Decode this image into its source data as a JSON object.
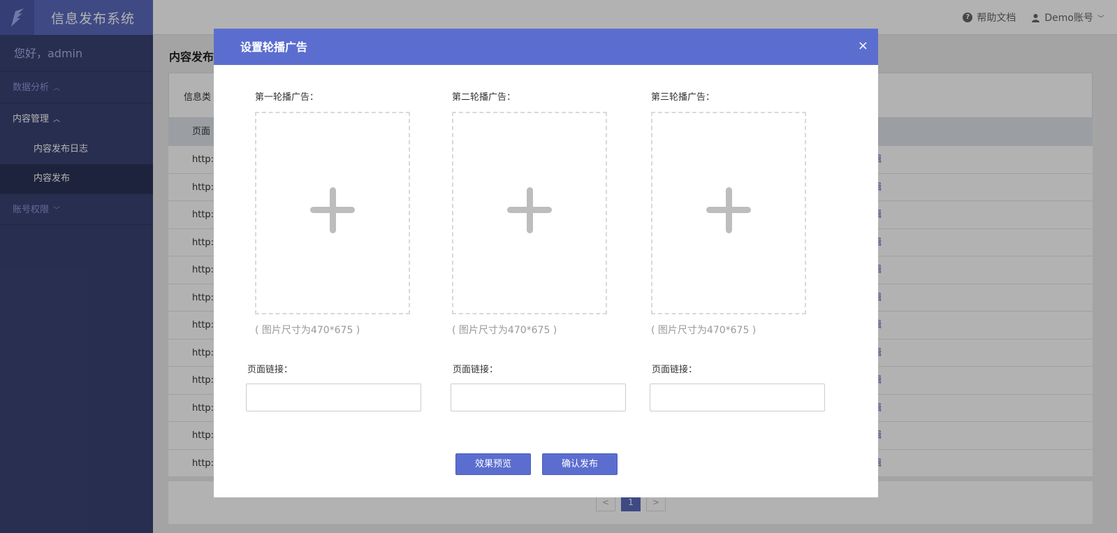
{
  "app": {
    "title": "信息发布系统",
    "greeting": "您好，admin"
  },
  "sidebar": {
    "groups": [
      {
        "label": "数据分析",
        "caret": "^"
      },
      {
        "label": "内容管理",
        "caret": "^"
      },
      {
        "label": "账号权限",
        "caret": "v"
      }
    ],
    "submenu": [
      "内容发布日志",
      "内容发布"
    ]
  },
  "topbar": {
    "help": "帮助文档",
    "account": "Demo账号"
  },
  "main": {
    "title": "内容发布",
    "filter_label": "信息类",
    "table_header": "页面",
    "row_url": "http:/",
    "row_action": "辑",
    "pager": {
      "prev": "<",
      "current": "1",
      "next": ">"
    }
  },
  "modal": {
    "title": "设置轮播广告",
    "close": "×",
    "slots": [
      {
        "label": "第一轮播广告：",
        "hint": "( 图片尺寸为470*675 )",
        "link_label": "页面链接：",
        "link_value": ""
      },
      {
        "label": "第二轮播广告：",
        "hint": "( 图片尺寸为470*675 )",
        "link_label": "页面链接：",
        "link_value": ""
      },
      {
        "label": "第三轮播广告：",
        "hint": "( 图片尺寸为470*675 )",
        "link_label": "页面链接：",
        "link_value": ""
      }
    ],
    "preview_button": "效果预览",
    "publish_button": "确认发布"
  },
  "colors": {
    "accent": "#5b6ed0",
    "sidebar": "#3a4372",
    "sidebar_text": "#8d99e0"
  }
}
